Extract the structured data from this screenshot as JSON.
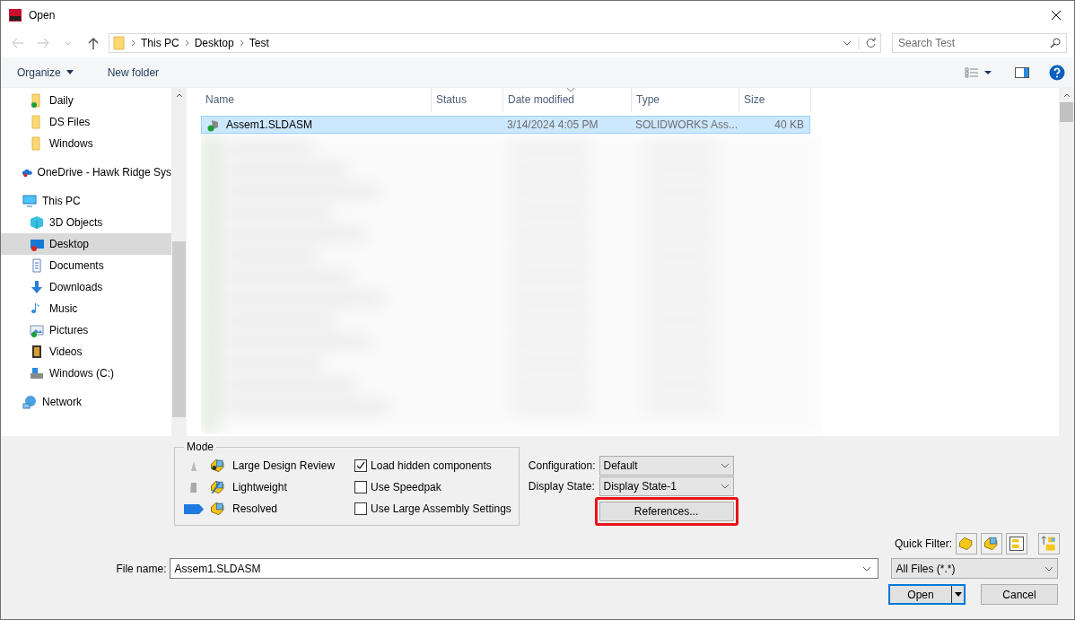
{
  "window": {
    "title": "Open"
  },
  "address": {
    "path": [
      "This PC",
      "Desktop",
      "Test"
    ],
    "search_placeholder": "Search Test"
  },
  "command_bar": {
    "organize": "Organize",
    "new_folder": "New folder"
  },
  "sidebar": [
    {
      "children": [
        {
          "label": "Daily",
          "kind": "folder",
          "color": "#1a9f35",
          "selected": false
        },
        {
          "label": "DS Files",
          "kind": "folder",
          "selected": false
        },
        {
          "label": "Windows",
          "kind": "folder",
          "selected": false
        }
      ]
    },
    {
      "label": "OneDrive - Hawk Ridge Sys",
      "kind": "cloud",
      "color": "#d8232a",
      "selected": false
    },
    {
      "label": "This PC",
      "kind": "pc",
      "selected": false,
      "children": [
        {
          "label": "3D Objects",
          "kind": "cube",
          "selected": false
        },
        {
          "label": "Desktop",
          "kind": "desktop",
          "color": "#d8232a",
          "selected": true
        },
        {
          "label": "Documents",
          "kind": "documents",
          "selected": false
        },
        {
          "label": "Downloads",
          "kind": "downloads",
          "selected": false
        },
        {
          "label": "Music",
          "kind": "music",
          "selected": false
        },
        {
          "label": "Pictures",
          "kind": "pictures",
          "color": "#1a9f35",
          "selected": false
        },
        {
          "label": "Videos",
          "kind": "videos",
          "selected": false
        },
        {
          "label": "Windows (C:)",
          "kind": "drive",
          "selected": false
        }
      ]
    },
    {
      "label": "Network",
      "kind": "network",
      "selected": false
    }
  ],
  "table": {
    "columns": [
      {
        "label": "Name",
        "sorted": false
      },
      {
        "label": "Status",
        "sorted": false
      },
      {
        "label": "Date modified",
        "sorted": true
      },
      {
        "label": "Type",
        "sorted": false
      },
      {
        "label": "Size",
        "sorted": false
      }
    ],
    "rows": [
      {
        "name": "Assem1.SLDASM",
        "status_ok": true,
        "date": "3/14/2024 4:05 PM",
        "type": "SOLIDWORKS Ass...",
        "size": "40 KB",
        "selected": true
      }
    ]
  },
  "mode": {
    "title": "Mode",
    "options": [
      {
        "label": "Large Design Review",
        "selected": false
      },
      {
        "label": "Lightweight",
        "selected": false
      },
      {
        "label": "Resolved",
        "selected": true
      }
    ],
    "checkboxes": [
      {
        "label": "Load hidden components",
        "checked": true
      },
      {
        "label": "Use Speedpak",
        "checked": false
      },
      {
        "label": "Use Large Assembly Settings",
        "checked": false
      }
    ]
  },
  "options": {
    "configuration_label": "Configuration:",
    "configuration": "Default",
    "display_state_label": "Display State:",
    "display_state": "Display State-1",
    "references": "References...",
    "references_highlighted": true
  },
  "quick_filter": {
    "label": "Quick Filter:",
    "filters": [
      {
        "kind": "part"
      },
      {
        "kind": "assembly"
      },
      {
        "kind": "drawing"
      },
      {
        "kind": "top-level"
      }
    ]
  },
  "file_name": {
    "label": "File name:",
    "value": "Assem1.SLDASM"
  },
  "file_type": "All Files (*.*)",
  "buttons": {
    "open": "Open",
    "cancel": "Cancel"
  }
}
